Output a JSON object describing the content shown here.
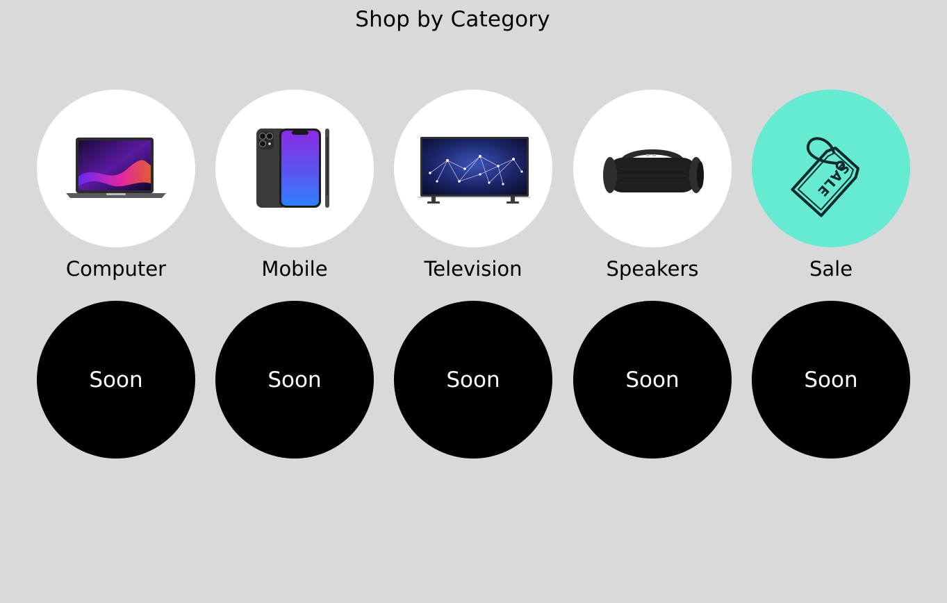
{
  "page": {
    "title": "Shop by Category"
  },
  "categories": [
    {
      "label": "Computer",
      "icon": "laptop-icon"
    },
    {
      "label": "Mobile",
      "icon": "smartphone-icon"
    },
    {
      "label": "Television",
      "icon": "television-icon"
    },
    {
      "label": "Speakers",
      "icon": "speaker-icon"
    },
    {
      "label": "Sale",
      "icon": "sale-tag-icon",
      "accent": "#66ebd2"
    }
  ],
  "upcoming": [
    {
      "label": "Soon"
    },
    {
      "label": "Soon"
    },
    {
      "label": "Soon"
    },
    {
      "label": "Soon"
    },
    {
      "label": "Soon"
    }
  ],
  "colors": {
    "background": "#d9d9d9",
    "tile": "#ffffff",
    "sale_tile": "#66ebd2",
    "soon_tile": "#000000",
    "soon_text": "#ffffff"
  }
}
